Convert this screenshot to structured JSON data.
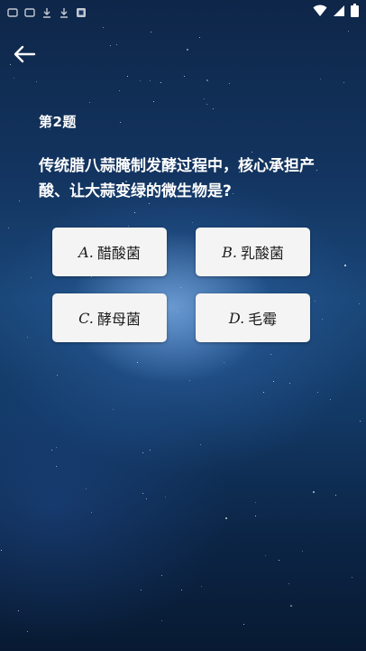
{
  "status_bar": {
    "left_icons": [
      "notification-icon",
      "notification-icon",
      "download-icon",
      "download-icon",
      "app-icon"
    ],
    "right_icons": [
      "wifi-icon",
      "signal-icon",
      "battery-icon"
    ]
  },
  "nav": {
    "back_icon": "back-arrow-icon"
  },
  "question": {
    "number_label": "第2题",
    "text": "传统腊八蒜腌制发酵过程中，核心承担产酸、让大蒜变绿的微生物是?"
  },
  "options": [
    {
      "letter": "A.",
      "label": "醋酸菌"
    },
    {
      "letter": "B.",
      "label": "乳酸菌"
    },
    {
      "letter": "C.",
      "label": "酵母菌"
    },
    {
      "letter": "D.",
      "label": "毛霉"
    }
  ],
  "colors": {
    "background_top": "#0e2648",
    "background_mid": "#1a4779",
    "background_bottom": "#081a33",
    "option_bg": "#f4f4f4",
    "option_text": "#1c1c1c",
    "text": "#ffffff"
  }
}
